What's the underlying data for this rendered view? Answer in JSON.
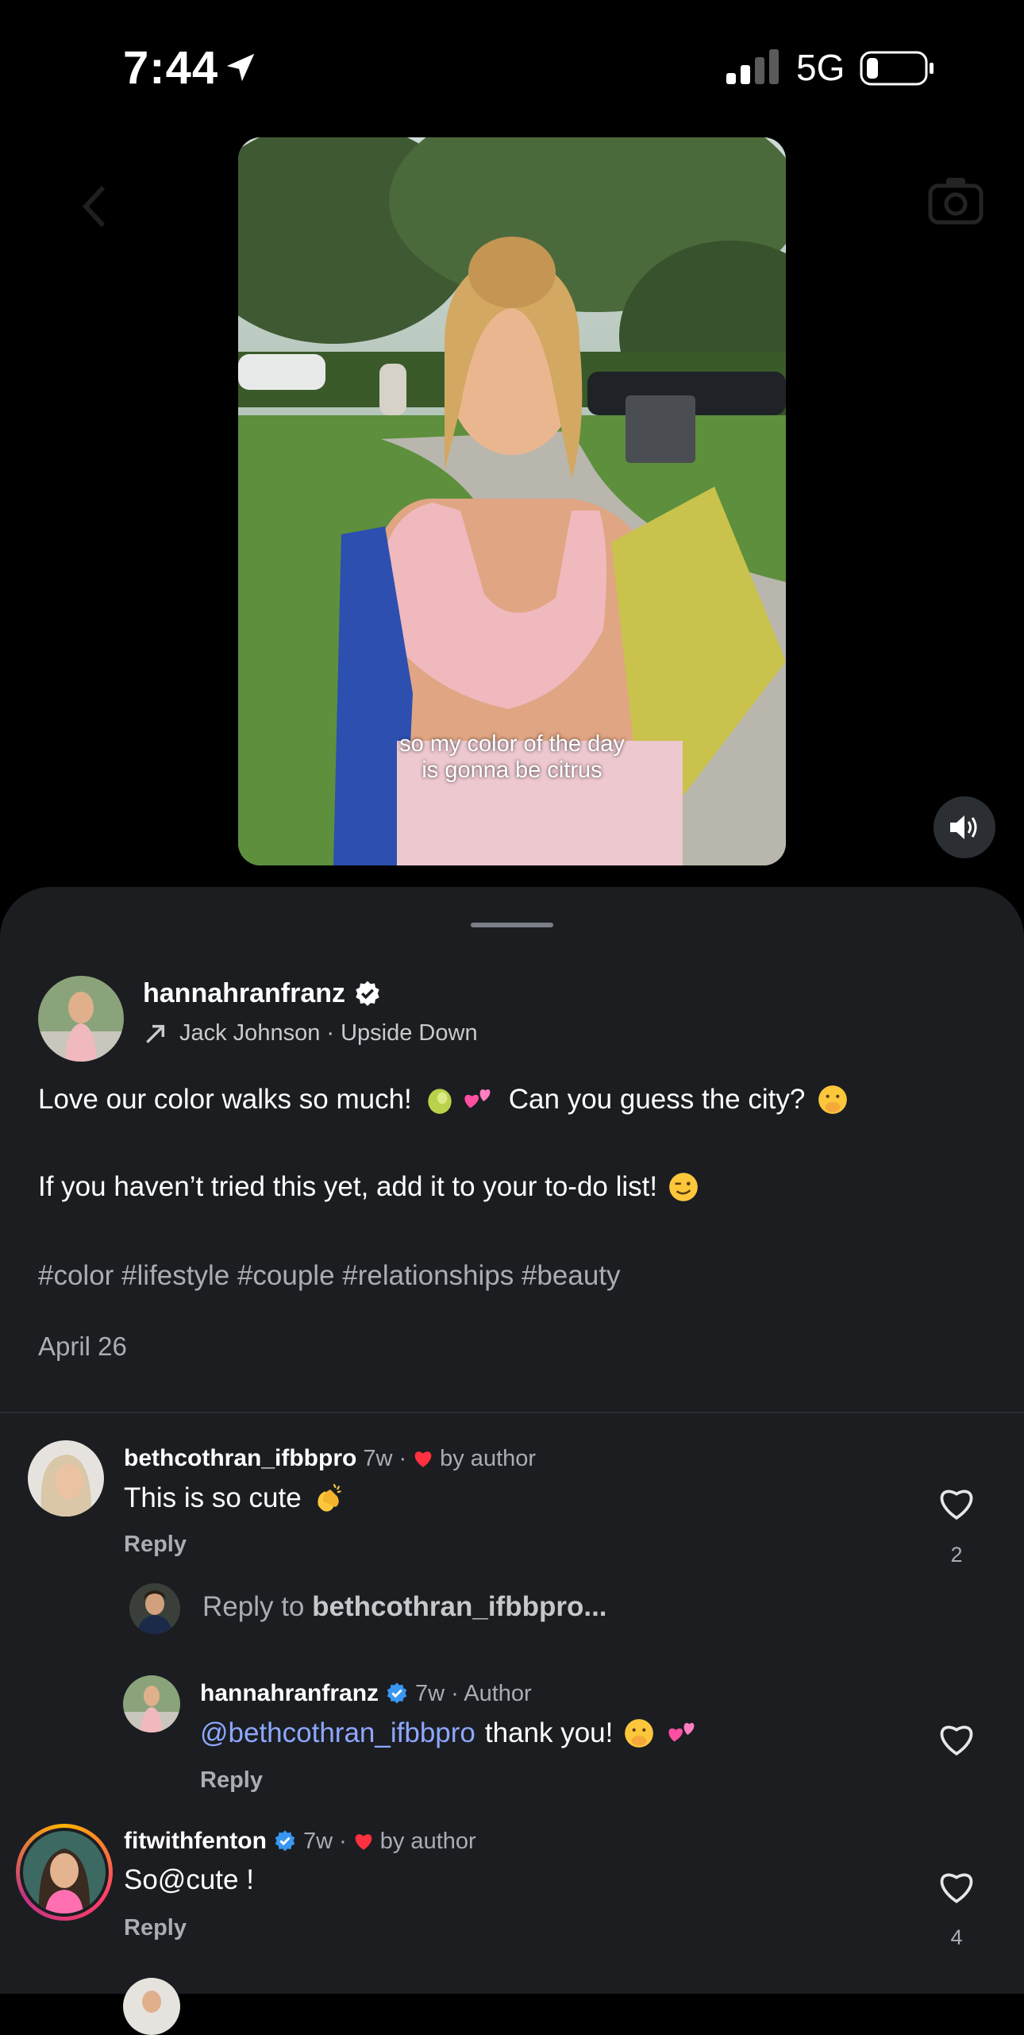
{
  "status_bar": {
    "time": "7:44",
    "network": "5G"
  },
  "video": {
    "caption_lines": [
      "so my color of the day",
      "is gonna be citrus"
    ]
  },
  "post": {
    "username": "hannahranfranz",
    "music": "Jack Johnson · Upside Down",
    "line1": "Love our color walks so much!",
    "line1_mid": "Can you guess the city?",
    "line2": "If you haven’t tried this yet, add it to your to-do list!",
    "hashtags": "#color #lifestyle #couple #relationships #beauty",
    "date": "April 26"
  },
  "comments": [
    {
      "username": "bethcothran_ifbbpro",
      "time": "7w ·",
      "by_author": "by author",
      "text": "This is so cute",
      "reply": "Reply",
      "likes": "2"
    },
    {
      "username": "hannahranfranz",
      "time": "7w · Author",
      "mention": "@bethcothran_ifbbpro",
      "text": "thank you!",
      "reply": "Reply"
    },
    {
      "username": "fitwithfenton",
      "time": "7w ·",
      "by_author": "by author",
      "text": "So@cute !",
      "reply": "Reply",
      "likes": "4"
    }
  ],
  "reply_prompt": {
    "prefix": "Reply to",
    "target": "bethcothran_ifbbpro..."
  },
  "icons": {
    "location": "location-arrow-icon",
    "signal": "cellular-signal-icon",
    "battery": "battery-icon",
    "sound": "speaker-icon",
    "verified": "verified-badge-icon",
    "music": "music-arrow-icon",
    "heart": "heart-icon"
  },
  "colors": {
    "sheet_bg": "#1b1d21",
    "mention": "#8ea7ff",
    "verified": "#3897f0",
    "heart_red": "#ff3040"
  }
}
